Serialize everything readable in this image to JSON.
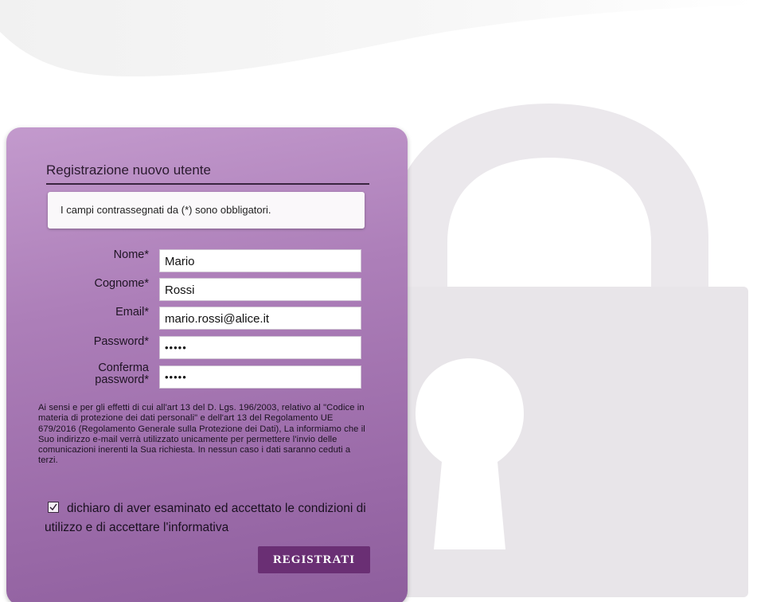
{
  "form": {
    "title": "Registrazione nuovo utente",
    "notice": "I campi contrassegnati da (*) sono obbligatori.",
    "fields": {
      "nome": {
        "label": "Nome*",
        "value": "Mario"
      },
      "cognome": {
        "label": "Cognome*",
        "value": "Rossi"
      },
      "email": {
        "label": "Email*",
        "value": "mario.rossi@alice.it"
      },
      "password": {
        "label": "Password*",
        "value": "•••••"
      },
      "conferma_password": {
        "label_line1": "Conferma",
        "label_line2": "password*",
        "value": "•••••"
      }
    },
    "privacy_text": "Ai sensi e per gli effetti di cui all'art 13 del D. Lgs. 196/2003, relativo al \"Codice in materia di protezione dei dati personali\" e dell'art 13 del Regolamento UE 679/2016 (Regolamento Generale sulla Protezione dei Dati), La informiamo che il Suo indirizzo e-mail verrà utilizzato unicamente per permettere l'invio delle comunicazioni inerenti la Sua richiesta. In nessun caso i dati saranno ceduti a terzi.",
    "consent": {
      "checked": true,
      "label": "dichiaro di aver esaminato ed accettato le condizioni di utilizzo e di accettare l'informativa"
    },
    "submit_label": "REGISTRATI"
  },
  "colors": {
    "panel": "#ad7fb9",
    "button": "#6a2f74",
    "padlock": "#e9e6ea"
  },
  "icons": {
    "background": "padlock-icon",
    "checkbox": "checkmark-icon"
  }
}
